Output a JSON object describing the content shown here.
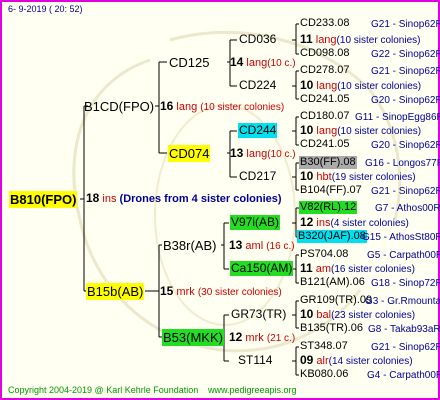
{
  "date": "6-  9-2019 ( 20: 52)",
  "footer": {
    "copyright": "Copyright 2004-2019 @ Karl Kehrle Foundation",
    "url": "www.pedigreeapis.org"
  },
  "colors": {
    "border": "#e000e0",
    "root": "#ffff00",
    "green": "#22dd22",
    "cyan": "#00e0ee",
    "grey": "#aaaaaa",
    "red_text": "#cc0000",
    "blue_text": "#000099"
  },
  "root": {
    "code": "B810(FPO)",
    "num": "18",
    "name": "ins",
    "note": "(Drones from 4 sister colonies)"
  },
  "g1": {
    "a": {
      "code": "B1CD(FPO)",
      "num": "16",
      "name": "lang",
      "sib": "(10 sister colonies)"
    },
    "b": {
      "code": "B15b(AB)",
      "num": "15",
      "name": "mrk",
      "sib": "(30 sister colonies)"
    }
  },
  "g2": {
    "a": {
      "code": "CD125",
      "num": "14",
      "name": "lang",
      "sib": "(10 c.)"
    },
    "b": {
      "code": "CD074",
      "num": "13",
      "name": "lang",
      "sib": "(10 c.)"
    },
    "c": {
      "code": "B38r(AB)",
      "num": "13",
      "name": "aml",
      "sib": "(16 c.)"
    },
    "d": {
      "code": "B53(MKK)",
      "num": "12",
      "name": "mrk",
      "sib": "(21 c.)"
    }
  },
  "g3": {
    "a": {
      "code": "CD036",
      "num": "11",
      "name": "lang",
      "sib": "(10 sister colonies)",
      "top": {
        "code": "CD233.08",
        "id": "G21 - Sinop62R"
      },
      "bot": {
        "code": "CD098.08",
        "id": "G22 - Sinop62R"
      }
    },
    "b": {
      "code": "CD224",
      "num": "10",
      "name": "lang",
      "sib": "(10 sister colonies)",
      "top": {
        "code": "CD278.07",
        "id": "G21 - Sinop62R"
      },
      "bot": {
        "code": "CD241.05",
        "id": "G20 - Sinop62R"
      }
    },
    "c": {
      "code": "CD244",
      "num": "10",
      "name": "lang",
      "sib": "(10 sister colonies)",
      "top": {
        "code": "CD180.07",
        "id": "G11 - SinopEgg86R"
      },
      "bot": {
        "code": "CD241.05",
        "id": "G20 - Sinop62R"
      }
    },
    "d": {
      "code": "CD217",
      "num": "10",
      "name": "hbt",
      "sib": "(19 sister colonies)",
      "top": {
        "code": "B30(FF).08",
        "id": "G16 - Longos77R"
      },
      "bot": {
        "code": "B104(FF).07",
        "id": "G21 - Sinop62R"
      }
    },
    "e": {
      "code": "V97i(AB)",
      "num": "12",
      "name": "ins",
      "sib": "(4 sister colonies)",
      "top": {
        "code": "V82(RL).12",
        "id": "G7 - Athos00R"
      },
      "bot": {
        "code": "B320(JAF).08",
        "id": "G15 - AthosSt80R"
      }
    },
    "f": {
      "code": "Ca150(AM)",
      "num": "11",
      "name": "am",
      "sib": "(16 sister colonies)",
      "top": {
        "code": "PS704.08",
        "id": "G5 - Carpath00R"
      },
      "bot": {
        "code": "B121(AM).06",
        "id": "G18 - Sinop72R"
      }
    },
    "g": {
      "code": "GR73(TR)",
      "num": "10",
      "name": "bal",
      "sib": "(23 sister colonies)",
      "top": {
        "code": "GR109(TR).09",
        "id": "G3 - Gr.Rmounta"
      },
      "bot": {
        "code": "B135(TR).06",
        "id": "G8 - Takab93aR"
      }
    },
    "h": {
      "code": "ST114",
      "num": "09",
      "name": "alr",
      "sib": "(14 sister colonies)",
      "top": {
        "code": "ST348.07",
        "id": "G21 - Sinop62R"
      },
      "bot": {
        "code": "KB080.06",
        "id": "G4 - Carpath00R"
      }
    }
  }
}
